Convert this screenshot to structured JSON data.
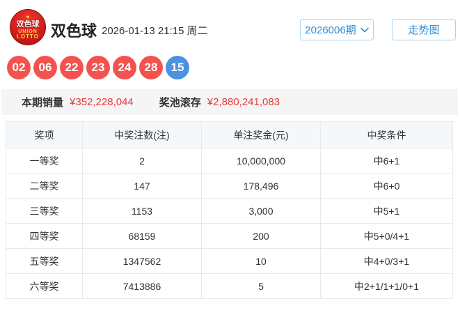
{
  "header": {
    "logo": {
      "cn": "双色球",
      "en1": "UNION",
      "en2": "LOTTO"
    },
    "title": "双色球",
    "datetime": "2026-01-13 21:15 周二",
    "issue_select": "2026006期",
    "trend_button": "走势图"
  },
  "balls": [
    {
      "num": "02",
      "color": "red"
    },
    {
      "num": "06",
      "color": "red"
    },
    {
      "num": "22",
      "color": "red"
    },
    {
      "num": "23",
      "color": "red"
    },
    {
      "num": "24",
      "color": "red"
    },
    {
      "num": "28",
      "color": "red"
    },
    {
      "num": "15",
      "color": "blue"
    }
  ],
  "stats": {
    "sales_label": "本期销量",
    "sales_value": "¥352,228,044",
    "pool_label": "奖池滚存",
    "pool_value": "¥2,880,241,083"
  },
  "table": {
    "headers": [
      "奖项",
      "中奖注数(注)",
      "单注奖金(元)",
      "中奖条件"
    ],
    "rows": [
      [
        "一等奖",
        "2",
        "10,000,000",
        "中6+1"
      ],
      [
        "二等奖",
        "147",
        "178,496",
        "中6+0"
      ],
      [
        "三等奖",
        "1153",
        "3,000",
        "中5+1"
      ],
      [
        "四等奖",
        "68159",
        "200",
        "中5+0/4+1"
      ],
      [
        "五等奖",
        "1347562",
        "10",
        "中4+0/3+1"
      ],
      [
        "六等奖",
        "7413886",
        "5",
        "中2+1/1+1/0+1"
      ]
    ]
  },
  "colors": {
    "red_ball": "#f4524e",
    "blue_ball": "#4b92e3",
    "accent_red": "#e43c3b",
    "accent_blue": "#2b8fd9",
    "table_header_bg": "#f4f8fb",
    "stats_bg": "#f5f5f6"
  }
}
